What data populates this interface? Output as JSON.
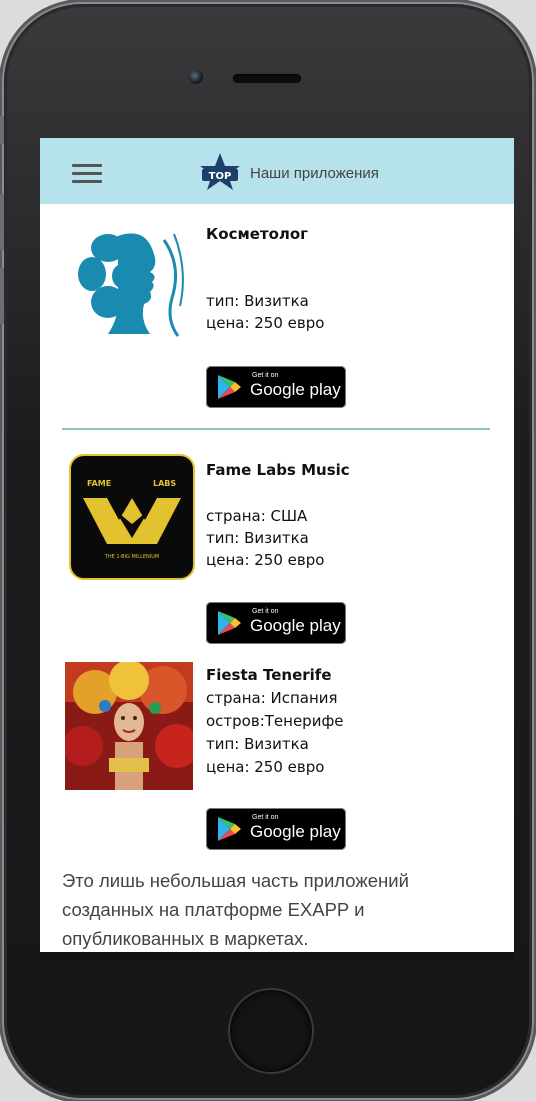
{
  "header": {
    "title": "Наши приложения",
    "logo_text": "TOP",
    "accent_color": "#b6e2ec"
  },
  "apps": [
    {
      "name": "Косметолог",
      "lines": [
        "тип: Визитка",
        "цена: 250 евро"
      ],
      "store_small": "Get it on",
      "store_big": "Google play"
    },
    {
      "name": "Fame Labs Music",
      "logo_top_left": "FAME",
      "logo_top_right": "LABS",
      "logo_bottom": "THE 1-BIG MILLENIUM",
      "lines": [
        "страна: США",
        "тип: Визитка",
        "цена: 250 евро"
      ],
      "store_small": "Get it on",
      "store_big": "Google play"
    },
    {
      "name": "Fiesta Tenerife",
      "lines": [
        "страна: Испания",
        "остров:Тенерифе",
        "тип: Визитка",
        "цена: 250 евро"
      ],
      "store_small": "Get it on",
      "store_big": "Google play"
    }
  ],
  "footer": {
    "text": "Это лишь небольшая часть приложений созданных на платформе EXAPP и опубликованных в маркетах."
  }
}
